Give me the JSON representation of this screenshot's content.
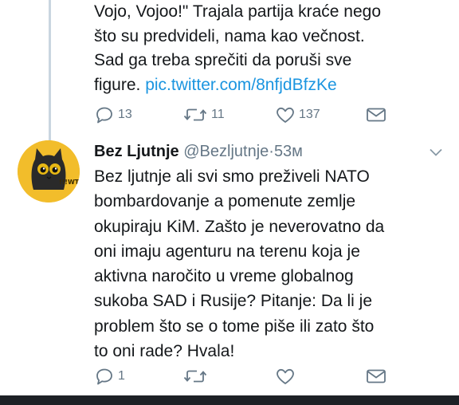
{
  "tweet1": {
    "lines": [
      "Vojo, Vojoo!\" Trajala partija kraće nego",
      "što su predvideli, nama kao večnost.",
      "Sad ga treba sprečiti da poruši sve"
    ],
    "last_line_prefix": "figure. ",
    "link": "pic.twitter.com/8nfjdBfzKe",
    "actions": {
      "replies": "13",
      "retweets": "11",
      "likes": "137"
    }
  },
  "tweet2": {
    "name": "Bez Ljutnje",
    "handle": "@Bezljutnje",
    "separator": "·",
    "time": "53м",
    "avatar_caption": "!!!WT",
    "lines": [
      "Bez ljutnje ali svi smo preživeli NATO",
      "bombardovanje a pomenute zemlje",
      "okupiraju KiM. Zašto je neverovatno da",
      "oni imaju agenturu na terenu koja je",
      "aktivna naročito u vreme globalnog",
      "sukoba SAD i Rusije? Pitanje: Da li je",
      "problem što se o tome piše ili zato što",
      "to oni rade? Hvala!"
    ],
    "actions": {
      "replies": "1"
    }
  },
  "icons": {
    "reply": "reply-icon",
    "retweet": "retweet-icon",
    "like": "heart-icon",
    "dm": "envelope-icon",
    "caret": "chevron-down-icon"
  },
  "colors": {
    "text": "#14171a",
    "secondary": "#657786",
    "link": "#1b95e0",
    "thread_line": "#c9d6e0",
    "avatar_bg": "#f2bd2b"
  }
}
